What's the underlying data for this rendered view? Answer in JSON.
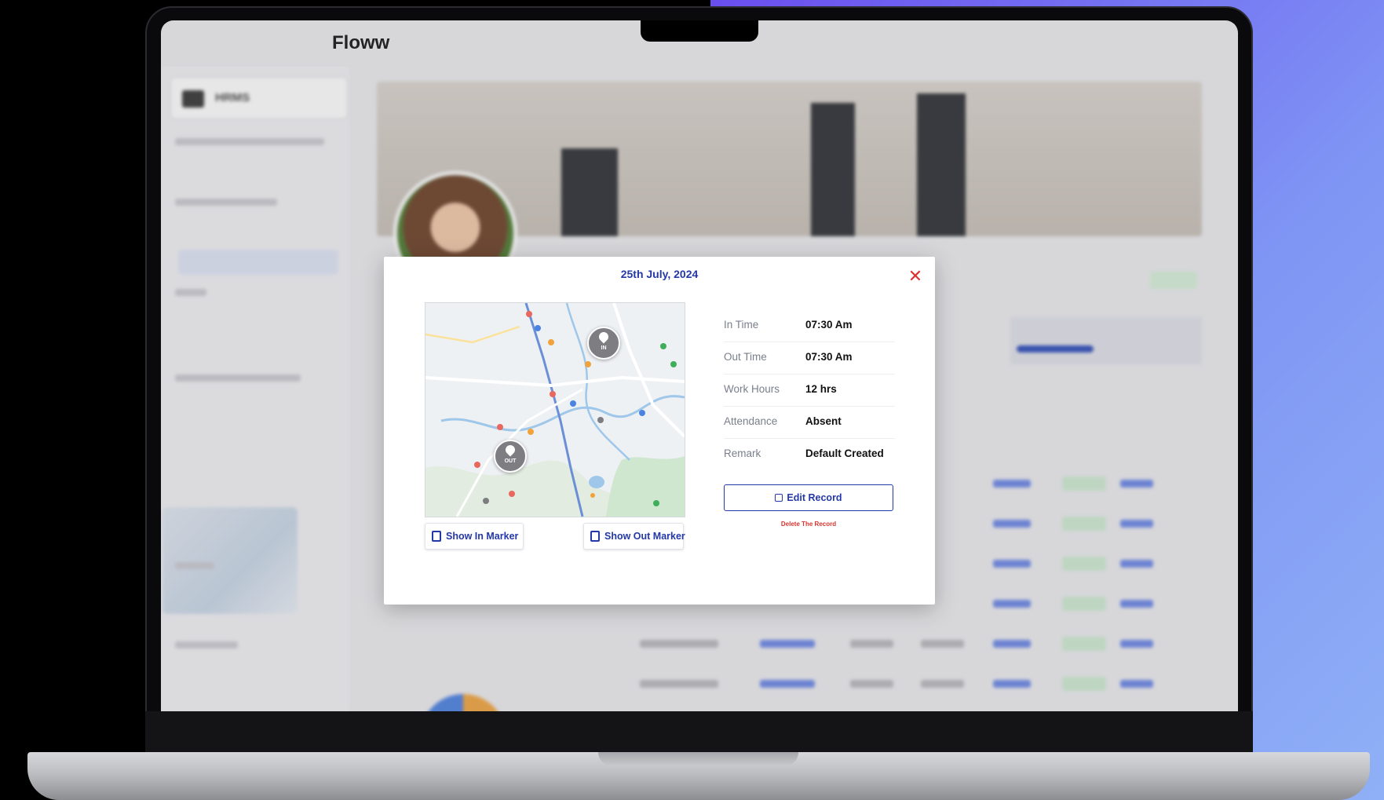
{
  "app": {
    "title": "Floww",
    "workspace": "HRMS"
  },
  "modal": {
    "date": "25th July, 2024",
    "close_icon": "close-icon",
    "map": {
      "in_marker_label": "IN",
      "out_marker_label": "OUT"
    },
    "buttons": {
      "show_in": "Show In Marker",
      "show_out": "Show Out Marker",
      "edit": "Edit Record",
      "delete": "Delete The Record"
    },
    "details": [
      {
        "label": "In Time",
        "value": "07:30 Am"
      },
      {
        "label": "Out Time",
        "value": "07:30 Am"
      },
      {
        "label": "Work Hours",
        "value": "12 hrs"
      },
      {
        "label": "Attendance",
        "value": "Absent"
      },
      {
        "label": "Remark",
        "value": "Default Created"
      }
    ]
  },
  "colors": {
    "accent": "#2438a8",
    "danger": "#d9342f"
  }
}
